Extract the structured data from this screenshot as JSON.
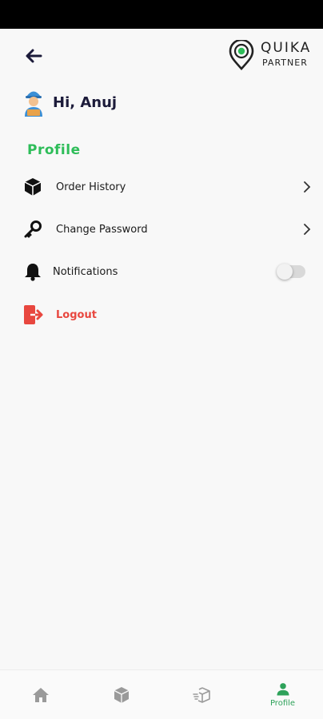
{
  "header": {
    "logo_name": "QUIKA",
    "logo_sub": "PARTNER"
  },
  "greeting": {
    "text": "Hi, Anuj"
  },
  "section": {
    "title": "Profile"
  },
  "menu": {
    "items": [
      {
        "label": "Order History",
        "icon": "package-icon"
      },
      {
        "label": "Change Password",
        "icon": "key-icon"
      },
      {
        "label": "Notifications",
        "icon": "bell-icon",
        "toggle": false
      },
      {
        "label": "Logout",
        "icon": "logout-icon"
      }
    ]
  },
  "bottom_nav": {
    "tabs": [
      {
        "name": "home",
        "icon": "home-icon",
        "label": ""
      },
      {
        "name": "orders",
        "icon": "box-icon",
        "label": ""
      },
      {
        "name": "deliveries",
        "icon": "delivery-box-icon",
        "label": ""
      },
      {
        "name": "profile",
        "icon": "person-icon",
        "label": "Profile",
        "active": true
      }
    ]
  },
  "colors": {
    "accent_green": "#2ebd59",
    "logout_red": "#e8473f",
    "dark_navy": "#1c1b3a"
  }
}
